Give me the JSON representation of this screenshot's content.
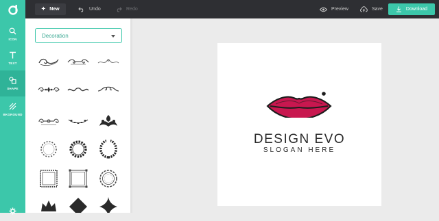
{
  "toolbar": {
    "new_label": "New",
    "undo_label": "Undo",
    "redo_label": "Redo",
    "preview_label": "Preview",
    "save_label": "Save",
    "download_label": "Download"
  },
  "sidebar": {
    "items": [
      {
        "label": "ICON",
        "icon": "search-icon"
      },
      {
        "label": "TEXT",
        "icon": "text-icon"
      },
      {
        "label": "SHAPE",
        "icon": "shape-icon"
      },
      {
        "label": "BKGROUND",
        "icon": "background-icon"
      }
    ],
    "settings_icon": "gear-icon"
  },
  "panel": {
    "category": "Decoration",
    "shapes": [
      "swirl-divider",
      "scroll-divider",
      "filigree-divider",
      "ornament-divider",
      "wave-divider",
      "curl-divider",
      "flourish-divider",
      "vine-divider",
      "floral-ornament",
      "dotted-wreath",
      "laurel-wreath",
      "leaf-wreath",
      "beaded-frame",
      "square-frame",
      "ornate-frame",
      "crown-shape",
      "diamond-shape",
      "star-shape"
    ]
  },
  "canvas": {
    "brand_name": "DESIGN EVO",
    "slogan": "SLOGAN HERE",
    "logo_icon": "lips-icon",
    "lip_color": "#c8174f"
  },
  "colors": {
    "accent": "#3cc7aa",
    "topbar": "#2e2f33"
  }
}
